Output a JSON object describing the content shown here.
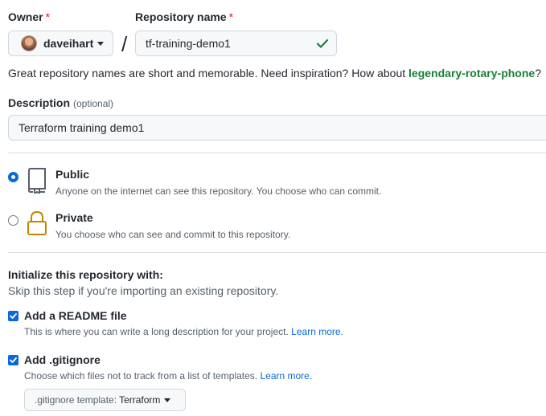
{
  "owner": {
    "label": "Owner",
    "required_mark": "*",
    "selected": "daveihart"
  },
  "separator": "/",
  "repository": {
    "label": "Repository name",
    "required_mark": "*",
    "value": "tf-training-demo1",
    "valid": true
  },
  "hint": {
    "text": "Great repository names are short and memorable. Need inspiration? How about ",
    "suggestion": "legendary-rotary-phone",
    "end": "?"
  },
  "description": {
    "label": "Description",
    "optional": "(optional)",
    "value": "Terraform training demo1"
  },
  "visibility": {
    "public": {
      "title": "Public",
      "text": "Anyone on the internet can see this repository. You choose who can commit.",
      "checked": true
    },
    "private": {
      "title": "Private",
      "text": "You choose who can see and commit to this repository.",
      "checked": false
    }
  },
  "init": {
    "title": "Initialize this repository with:",
    "subtitle": "Skip this step if you're importing an existing repository.",
    "readme": {
      "label": "Add a README file",
      "text": "This is where you can write a long description for your project.",
      "link": "Learn more.",
      "checked": true
    },
    "gitignore": {
      "label": "Add .gitignore",
      "text": "Choose which files not to track from a list of templates.",
      "link": "Learn more.",
      "checked": true
    },
    "template": {
      "prefix": ".gitignore template:",
      "value": "Terraform"
    }
  },
  "colors": {
    "accent": "#0969da",
    "success": "#1a7f37",
    "danger": "#cf222e",
    "lock": "#bf8700"
  }
}
